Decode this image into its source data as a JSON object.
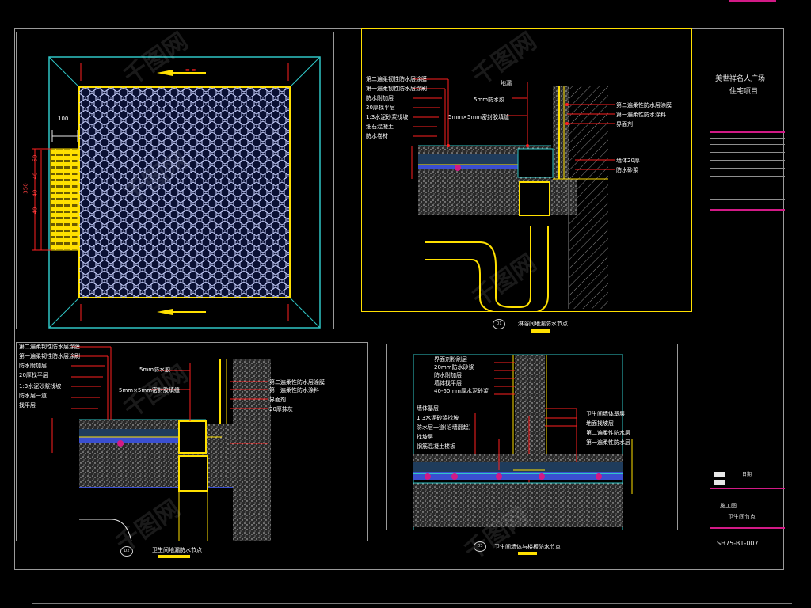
{
  "title_block": {
    "project_line1": "美世祥名人广场",
    "project_line2": "住宅项目",
    "sheet_line1": "施工图",
    "sheet_line2": "卫生间节点",
    "drawing_number": "SH75-B1-007",
    "small_label": "日期"
  },
  "plan_view": {
    "dimension_top": "100",
    "dimension_side": "350",
    "side_dims": [
      "50",
      "10",
      "40",
      "10",
      "40",
      "10",
      "40",
      "10"
    ]
  },
  "details": {
    "d1": {
      "tag": "D1",
      "caption": "淋浴间地漏防水节点"
    },
    "d2": {
      "tag": "D2",
      "caption": "卫生间地漏防水节点"
    },
    "d3": {
      "tag": "D3",
      "caption": "卫生间墙体与楼板防水节点"
    }
  },
  "d1_leaders_left": [
    "第二遍柔韧性防水层涂膜",
    "第一遍柔韧性防水层涂刷",
    "防水附加层",
    "20厚找平层",
    "1:3水泥砂浆找坡",
    "细石混凝土",
    "防水卷材"
  ],
  "d1_leaders_right": [
    "第二遍柔性防水层涂膜",
    "第一遍柔性防水涂料",
    "界面剂",
    "墙体20厚",
    "防水砂浆"
  ],
  "d1_mid_labels": [
    "地漏",
    "5mm防水胶",
    "5mm×5mm密封胶填缝"
  ],
  "d2_leaders_left": [
    "第二遍柔韧性防水层涂膜",
    "第一遍柔韧性防水层涂刷",
    "防水附加层",
    "20厚找平层",
    "1:3水泥砂浆找坡",
    "防水层一道",
    "找平层"
  ],
  "d2_mid_labels": [
    "5mm防水胶",
    "5mm×5mm密封胶填缝"
  ],
  "d2_leaders_right": [
    "第二遍柔性防水层涂膜",
    "第一遍柔性防水涂料",
    "界面剂",
    "20厚抹灰"
  ],
  "d3_leaders_left": [
    "界面剂粉刷层",
    "20mm防水砂浆",
    "防水附加层",
    "墙体找平层",
    "40-60mm厚水泥砂浆",
    "墙体基层",
    "1:3水泥砂浆找坡",
    "防水层一道(沿墙翻起)",
    "找坡层",
    "钢筋混凝土楼板"
  ],
  "d3_leaders_right": [
    "卫生间墙体基层",
    "地面找坡层",
    "第二遍柔性防水层",
    "第一遍柔性防水层"
  ],
  "colors": {
    "cyan": "#2fc6c6",
    "yellow": "#ffe000",
    "red": "#ff2020",
    "magenta": "#d21a86",
    "blue_fill": "#3a4fd0",
    "white": "#e8e8e8"
  },
  "watermark": "千图网"
}
